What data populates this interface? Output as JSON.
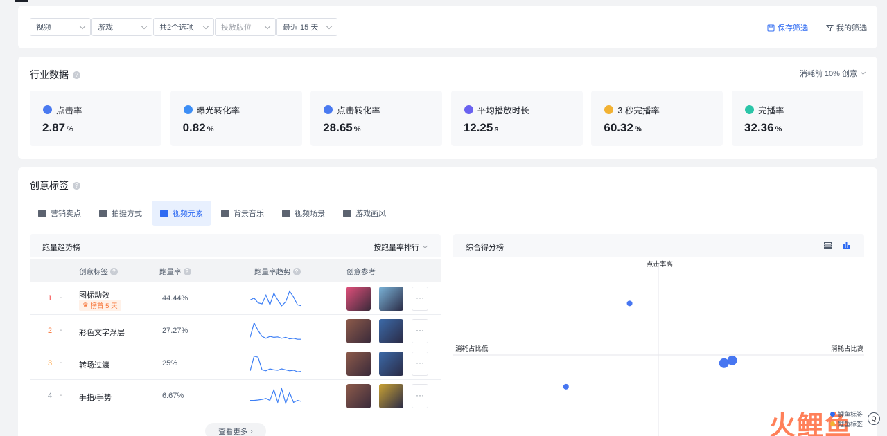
{
  "filters": {
    "selects": [
      {
        "value": "视频",
        "placeholder": false
      },
      {
        "value": "游戏",
        "placeholder": false
      },
      {
        "value": "共2个选项",
        "placeholder": false
      },
      {
        "value": "投放版位",
        "placeholder": true
      },
      {
        "value": "最近 15 天",
        "placeholder": false
      }
    ],
    "save_label": "保存筛选",
    "my_label": "我的筛选"
  },
  "industry": {
    "title": "行业数据",
    "scope_label": "消耗前 10% 创意",
    "metrics": [
      {
        "label": "点击率",
        "value": "2.87",
        "unit": "%",
        "icon": "click-icon",
        "color": "#4a7af0"
      },
      {
        "label": "曝光转化率",
        "value": "0.82",
        "unit": "%",
        "icon": "exposure-icon",
        "color": "#3d8ef5"
      },
      {
        "label": "点击转化率",
        "value": "28.65",
        "unit": "%",
        "icon": "click-convert-icon",
        "color": "#4a7af0"
      },
      {
        "label": "平均播放时长",
        "value": "12.25",
        "unit": "s",
        "icon": "clock-icon",
        "color": "#6a62f0"
      },
      {
        "label": "3 秒完播率",
        "value": "60.32",
        "unit": "%",
        "icon": "coin-icon",
        "color": "#f2b233"
      },
      {
        "label": "完播率",
        "value": "32.36",
        "unit": "%",
        "icon": "check-icon",
        "color": "#2bc5a8"
      }
    ]
  },
  "creative": {
    "title": "创意标签",
    "tabs": [
      {
        "label": "营销卖点",
        "icon": "tag-icon",
        "active": false
      },
      {
        "label": "拍摄方式",
        "icon": "camera-icon",
        "active": false
      },
      {
        "label": "视频元素",
        "icon": "thumbs-icon",
        "active": true
      },
      {
        "label": "背景音乐",
        "icon": "music-icon",
        "active": false
      },
      {
        "label": "视频场景",
        "icon": "building-icon",
        "active": false
      },
      {
        "label": "游戏画风",
        "icon": "palette-icon",
        "active": false
      }
    ],
    "ranking": {
      "title": "跑量趋势榜",
      "sort_label": "按跑量率排行",
      "columns": [
        "创意标签",
        "跑量率",
        "跑量率趋势",
        "创意参考"
      ],
      "rows": [
        {
          "rank": "1",
          "dash": "-",
          "name": "图标动效",
          "badge": "榜首 5 天",
          "rate": "44.44%",
          "rank_color": "#f53f3f",
          "trend": [
            0.45,
            0.55,
            0.3,
            0.25,
            0.7,
            0.2,
            0.8,
            0.45,
            0.15,
            0.35,
            0.9,
            0.6,
            0.2,
            0.15
          ],
          "thumbs": [
            "#e04f7a",
            "#7bb4d8"
          ]
        },
        {
          "rank": "2",
          "dash": "-",
          "name": "彩色文字浮层",
          "badge": "",
          "rate": "27.27%",
          "rank_color": "#f77234",
          "trend": [
            0.2,
            0.95,
            0.55,
            0.25,
            0.15,
            0.25,
            0.2,
            0.22,
            0.15,
            0.2,
            0.12,
            0.15,
            0.1,
            0.1
          ],
          "thumbs": [
            "#8c5a4a",
            "#3c6aa8"
          ]
        },
        {
          "rank": "3",
          "dash": "-",
          "name": "转场过渡",
          "badge": "",
          "rate": "25%",
          "rank_color": "#ff9a2e",
          "trend": [
            0.15,
            0.9,
            0.85,
            0.2,
            0.15,
            0.25,
            0.2,
            0.18,
            0.25,
            0.2,
            0.15,
            0.18,
            0.1,
            0.12
          ],
          "thumbs": [
            "#8c5a4a",
            "#3c6aa8"
          ]
        },
        {
          "rank": "4",
          "dash": "-",
          "name": "手指/手势",
          "badge": "",
          "rate": "6.67%",
          "rank_color": "#86909c",
          "trend": [
            0.3,
            0.3,
            0.32,
            0.35,
            0.4,
            0.3,
            0.85,
            0.2,
            0.9,
            0.15,
            0.7,
            0.2,
            0.3,
            0.25
          ],
          "thumbs": [
            "#8c5a4a",
            "#c9a234"
          ]
        }
      ],
      "see_more": "查看更多"
    },
    "score": {
      "title": "综合得分榜",
      "axis_top": "点击率高",
      "axis_left": "消耗占比低",
      "axis_right": "消耗占比高"
    }
  },
  "chart_data": {
    "type": "scatter",
    "title": "综合得分榜",
    "xlabel": "消耗占比",
    "ylabel": "点击率",
    "points": [
      {
        "x": -0.14,
        "y": 0.57,
        "size": 1
      },
      {
        "x": 0.32,
        "y": -0.09,
        "size": 2
      },
      {
        "x": 0.36,
        "y": -0.06,
        "size": 2
      },
      {
        "x": -0.45,
        "y": -0.35,
        "size": 1
      }
    ],
    "xlim": [
      -1,
      1
    ],
    "ylim": [
      -1,
      1
    ]
  },
  "watermark": {
    "text": "火鲤鱼",
    "legend": [
      "鲤鱼标签",
      "鲤鱼标签"
    ]
  }
}
